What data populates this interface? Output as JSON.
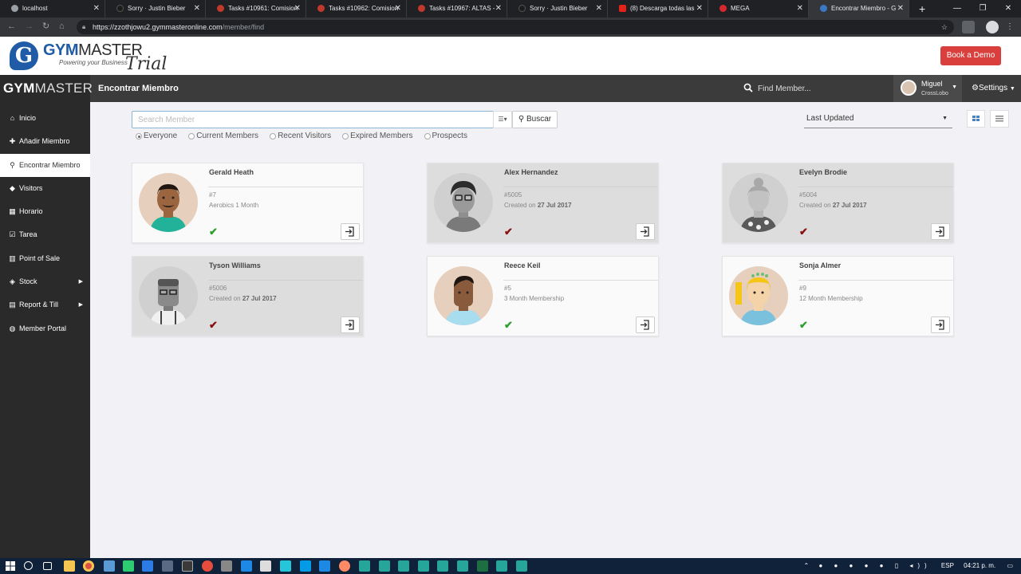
{
  "browser": {
    "tabs": [
      {
        "title": "localhost",
        "color": "#9aa0a6"
      },
      {
        "title": "Sorry · Justin Bieber",
        "color": "#1c1c1c"
      },
      {
        "title": "Tasks #10961: Comision",
        "color": "#c0392b"
      },
      {
        "title": "Tasks #10962: Comision",
        "color": "#c0392b"
      },
      {
        "title": "Tasks #10967: ALTAS - ",
        "color": "#c0392b"
      },
      {
        "title": "Sorry · Justin Bieber",
        "color": "#1c1c1c"
      },
      {
        "title": "(8) Descarga todas las",
        "color": "#e62117"
      },
      {
        "title": "MEGA",
        "color": "#d9272e"
      },
      {
        "title": "Encontrar Miembro - G",
        "color": "#3b78c4"
      }
    ],
    "url_host": "https://zzothjowu2.gymmasteronline.com",
    "url_path": "/member/find"
  },
  "header": {
    "logo_text_bold": "GYM",
    "logo_text_rest": "MASTER",
    "logo_tagline": "Powering your Business",
    "logo_trial": "Trial",
    "book_demo": "Book a Demo"
  },
  "topbar": {
    "brand_bold": "GYM",
    "brand_rest": "MASTER",
    "page_title": "Encontrar Miembro",
    "find_placeholder": "Find Member...",
    "user_name": "Miguel",
    "user_org": "CrossLobo",
    "settings": "Settings"
  },
  "sidebar": {
    "items": [
      {
        "label": "Inicio",
        "icon": "home-icon"
      },
      {
        "label": "Añadir Miembro",
        "icon": "plus-icon"
      },
      {
        "label": "Encontrar Miembro",
        "icon": "search-icon"
      },
      {
        "label": "Visitors",
        "icon": "tag-icon"
      },
      {
        "label": "Horario",
        "icon": "calendar-icon"
      },
      {
        "label": "Tarea",
        "icon": "checkbox-icon"
      },
      {
        "label": "Point of Sale",
        "icon": "grid-icon"
      },
      {
        "label": "Stock",
        "icon": "tags-icon"
      },
      {
        "label": "Report & Till",
        "icon": "print-icon"
      },
      {
        "label": "Member Portal",
        "icon": "globe-icon"
      }
    ]
  },
  "search": {
    "placeholder": "Search Member",
    "buscar": "Buscar",
    "filters": [
      "Everyone",
      "Current Members",
      "Recent Visitors",
      "Expired Members",
      "Prospects"
    ],
    "selected_filter": "Everyone",
    "sort_selected": "Last Updated"
  },
  "members": [
    {
      "name": "Gerald Heath",
      "id": "#7",
      "detail": "Aerobics 1 Month",
      "created_date": "",
      "status": "ok",
      "active": true
    },
    {
      "name": "Alex Hernandez",
      "id": "#5005",
      "detail": "Created on ",
      "created_date": "27 Jul 2017",
      "status": "bad",
      "active": false
    },
    {
      "name": "Evelyn Brodie",
      "id": "#5004",
      "detail": "Created on ",
      "created_date": "27 Jul 2017",
      "status": "bad",
      "active": false
    },
    {
      "name": "Tyson Williams",
      "id": "#5006",
      "detail": "Created on ",
      "created_date": "27 Jul 2017",
      "status": "bad",
      "active": false
    },
    {
      "name": "Reece Keil",
      "id": "#5",
      "detail": "3 Month Membership",
      "created_date": "",
      "status": "ok",
      "active": true
    },
    {
      "name": "Sonja Almer",
      "id": "#9",
      "detail": "12 Month Membership",
      "created_date": "",
      "status": "ok",
      "active": true
    }
  ],
  "taskbar": {
    "language": "ESP",
    "time": "04:21 p. m."
  },
  "colors": {
    "accent_red": "#d9403d",
    "ok_green": "#2e9e2e",
    "bad_red": "#8a0f0f",
    "sidebar_bg": "#2a2a2a"
  }
}
